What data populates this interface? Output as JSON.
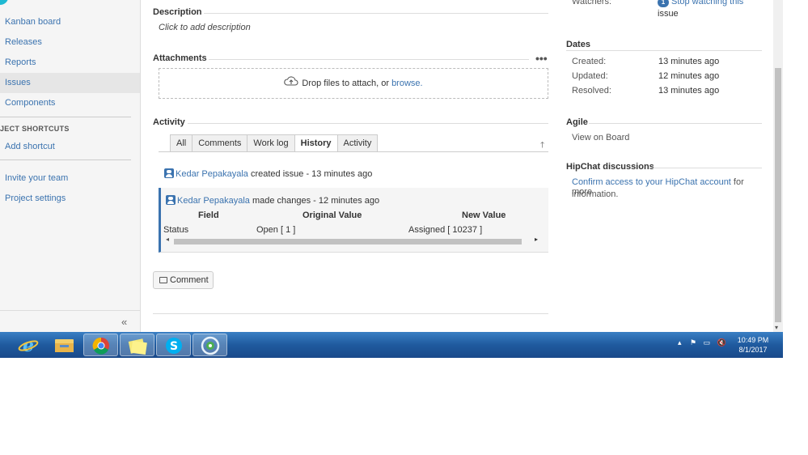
{
  "sidebar": {
    "items": [
      {
        "label": "Kanban board"
      },
      {
        "label": "Releases"
      },
      {
        "label": "Reports"
      },
      {
        "label": "Issues"
      },
      {
        "label": "Components"
      }
    ],
    "shortcuts_heading": "JECT SHORTCUTS",
    "add_shortcut": "Add shortcut",
    "invite_team": "Invite your team",
    "project_settings": "Project settings",
    "collapse": "«"
  },
  "main": {
    "description": {
      "title": "Description",
      "placeholder": "Click to add description"
    },
    "attachments": {
      "title": "Attachments",
      "more": "•••",
      "drop_text": "Drop files to attach, or ",
      "browse": "browse."
    },
    "activity": {
      "title": "Activity",
      "tabs": [
        "All",
        "Comments",
        "Work log",
        "History",
        "Activity"
      ],
      "active_tab": "History",
      "entries": [
        {
          "user": "Kedar Pepakayala",
          "action": " created issue - 13 minutes ago"
        },
        {
          "user": "Kedar Pepakayala",
          "action": " made changes - 12 minutes ago"
        }
      ],
      "table": {
        "headers": {
          "field": "Field",
          "original": "Original Value",
          "new": "New Value"
        },
        "row": {
          "field": "Status",
          "original": "Open [ 1 ]",
          "new": "Assigned [ 10237 ]"
        }
      }
    },
    "comment_button": "Comment"
  },
  "right": {
    "watchers": {
      "label": "Watchers:",
      "count": "1",
      "link_line1": "Stop watching this",
      "link_line2": "issue"
    },
    "dates": {
      "title": "Dates",
      "created_label": "Created:",
      "created": "13 minutes ago",
      "updated_label": "Updated:",
      "updated": "12 minutes ago",
      "resolved_label": "Resolved:",
      "resolved": "13 minutes ago"
    },
    "agile": {
      "title": "Agile",
      "link": "View on Board"
    },
    "hipchat": {
      "title": "HipChat discussions",
      "link": "Confirm access to your HipChat account",
      "text": " for more",
      "text2": "information."
    }
  },
  "taskbar": {
    "apps": [
      "internet-explorer",
      "file-explorer",
      "chrome",
      "sticky-notes",
      "skype",
      "app"
    ],
    "time": "10:49 PM",
    "date": "8/1/2017"
  },
  "colors": {
    "link": "#3b73af",
    "taskbar": "#1f5a9e",
    "active_border": "#3b73af"
  }
}
